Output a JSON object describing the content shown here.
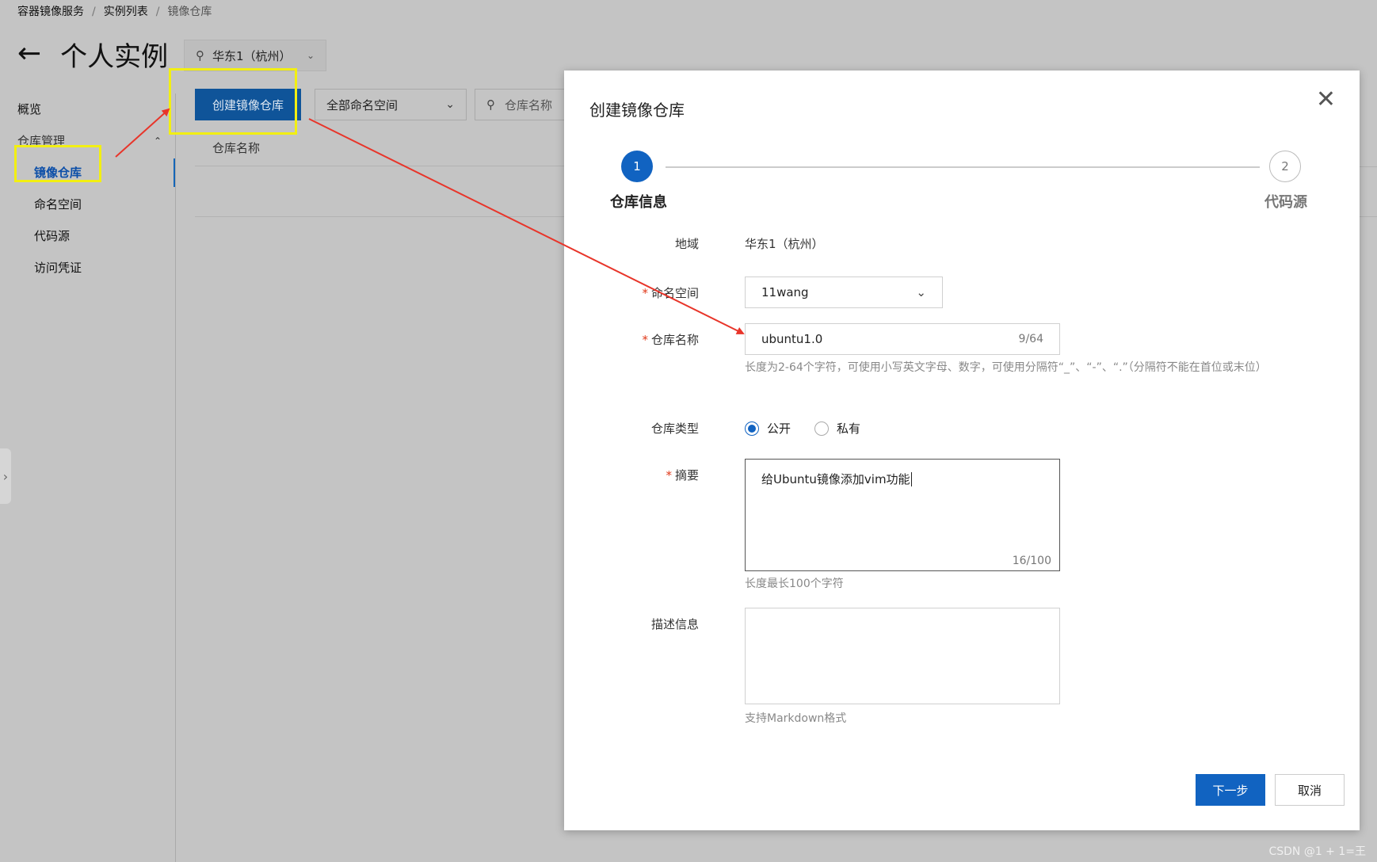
{
  "breadcrumb": [
    "容器镜像服务",
    "实例列表",
    "镜像仓库"
  ],
  "breadcrumb_sep": "/",
  "page": {
    "title": "个人实例",
    "region": "华东1（杭州）"
  },
  "sidebar": {
    "items": [
      {
        "label": "概览"
      },
      {
        "label": "仓库管理"
      },
      {
        "label": "镜像仓库"
      },
      {
        "label": "命名空间"
      },
      {
        "label": "代码源"
      },
      {
        "label": "访问凭证"
      }
    ]
  },
  "toolbar": {
    "create_label": "创建镜像仓库",
    "namespace_filter": "全部命名空间",
    "search_placeholder": "仓库名称"
  },
  "table": {
    "column_header": "仓库名称"
  },
  "modal": {
    "title": "创建镜像仓库",
    "steps": [
      {
        "number": "1",
        "label": "仓库信息"
      },
      {
        "number": "2",
        "label": "代码源"
      }
    ],
    "fields": {
      "region_label": "地域",
      "region_value": "华东1（杭州）",
      "namespace_label": "命名空间",
      "namespace_value": "11wang",
      "name_label": "仓库名称",
      "name_value": "ubuntu1.0",
      "name_count": "9/64",
      "name_hint": "长度为2-64个字符，可使用小写英文字母、数字，可使用分隔符“_”、“-”、“.”（分隔符不能在首位或末位）",
      "type_label": "仓库类型",
      "type_options": [
        "公开",
        "私有"
      ],
      "type_selected": "公开",
      "summary_label": "摘要",
      "summary_value": "给Ubuntu镜像添加vim功能",
      "summary_count": "16/100",
      "summary_hint": "长度最长100个字符",
      "desc_label": "描述信息",
      "desc_value": "",
      "desc_hint": "支持Markdown格式"
    },
    "next_label": "下一步",
    "cancel_label": "取消"
  },
  "watermark": "CSDN @1 + 1=王",
  "colors": {
    "primary": "#1163c1",
    "highlight": "#f2ef12",
    "arrow": "#e8352a",
    "required": "#e0391a"
  }
}
